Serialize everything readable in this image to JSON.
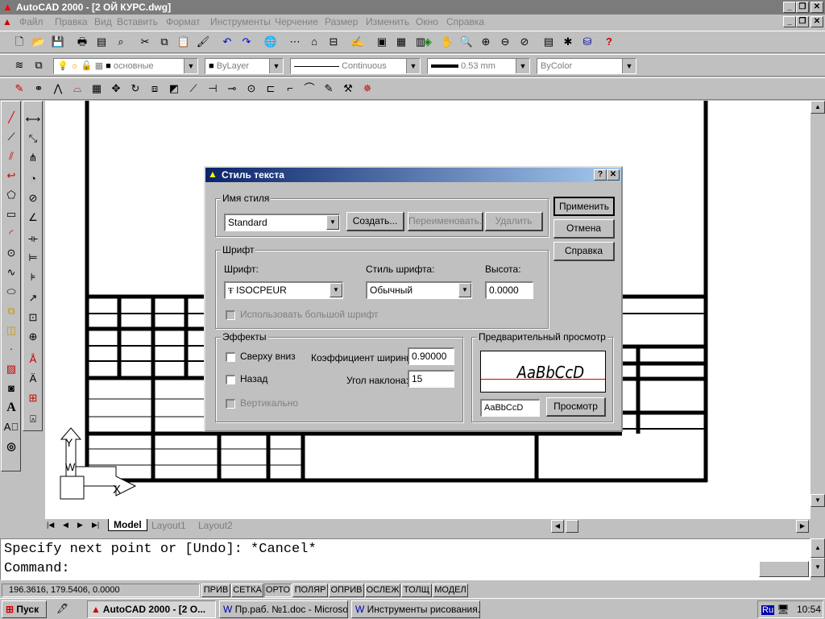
{
  "window": {
    "title": "AutoCAD 2000 - [2 ОЙ КУРС.dwg]",
    "title_color": "#7b7b7b"
  },
  "menu": [
    "Файл",
    "Правка",
    "Вид",
    "Вставить",
    "Формат",
    "Инструменты",
    "Черчение",
    "Размер",
    "Изменить",
    "Окно",
    "Справка"
  ],
  "properties_bar": {
    "layer": "основные",
    "color": "ByLayer",
    "linetype": "Continuous",
    "lineweight": "0.53 mm",
    "plotstyle": "ByColor"
  },
  "tabs": [
    "Model",
    "Layout1",
    "Layout2"
  ],
  "dialog": {
    "title": "Стиль текста",
    "style_name_group": "Имя стиля",
    "style_value": "Standard",
    "btn_create": "Создать...",
    "btn_rename": "Переименовать...",
    "btn_delete": "Удалить",
    "btn_apply": "Применить",
    "btn_cancel": "Отмена",
    "btn_help": "Справка",
    "font_group": "Шрифт",
    "font_label": "Шрифт:",
    "font_value": "ISOCPEUR",
    "font_style_label": "Стиль шрифта:",
    "font_style_value": "Обычный",
    "height_label": "Высота:",
    "height_value": "0.0000",
    "bigfont_label": "Использовать большой шрифт",
    "effects_group": "Эффекты",
    "upside_down": "Сверху вниз",
    "backwards": "Назад",
    "vertical": "Вертикально",
    "width_factor_label": "Коэффициент ширины:",
    "width_factor_value": "0.90000",
    "oblique_label": "Угол наклона:",
    "oblique_value": "15",
    "preview_group": "Предварительный просмотр",
    "preview_text": "AaBbCcD",
    "preview_input": "AaBbCcD",
    "preview_button": "Просмотр"
  },
  "command": {
    "line1": "Specify next point or [Undo]: *Cancel*",
    "line2": "Command:"
  },
  "status": {
    "coords": "196.3616, 179.5406, 0.0000",
    "toggles": [
      "ПРИВ",
      "СЕТКА",
      "ОРТО",
      "ПОЛЯР",
      "ОПРИВ",
      "ОСЛЕЖ",
      "ТОЛЩ",
      "МОДЕЛ"
    ]
  },
  "taskbar": {
    "start": "Пуск",
    "tasks": [
      "AutoCAD 2000 - [2 О...",
      "Пр.раб. №1.doc - Microso...",
      "Инструменты рисования..."
    ],
    "lang": "Ru",
    "clock": "10:54"
  },
  "ucs": {
    "y": "Y",
    "x": "X",
    "w": "W"
  }
}
